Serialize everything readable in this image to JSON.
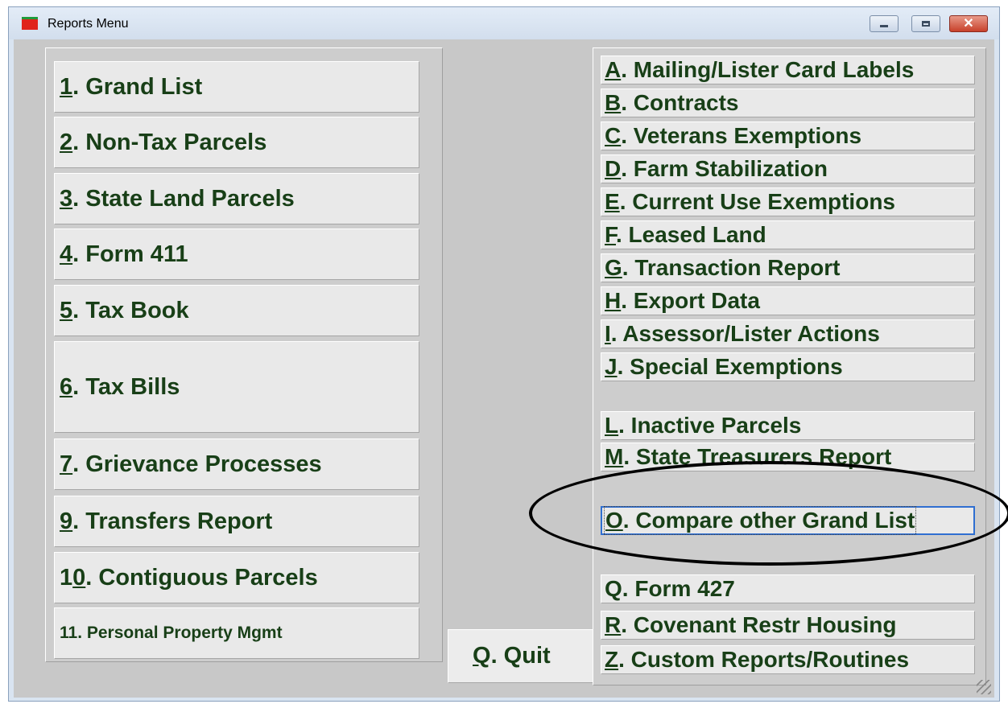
{
  "window": {
    "title": "Reports Menu",
    "controls": {
      "minimize": "minimize",
      "maximize": "maximize",
      "close": "✕"
    }
  },
  "left_menu": [
    {
      "key": "1",
      "rest": ".  Grand List"
    },
    {
      "key": "2",
      "rest": ".  Non-Tax Parcels"
    },
    {
      "key": "3",
      "rest": ".  State Land Parcels"
    },
    {
      "key": "4",
      "rest": ".  Form 411"
    },
    {
      "key": "5",
      "rest": ". Tax Book"
    },
    {
      "key": "6",
      "rest": ". Tax Bills"
    },
    {
      "key": "7",
      "rest": ". Grievance Processes"
    },
    {
      "key": "9",
      "rest": ". Transfers Report"
    },
    {
      "pre": "1",
      "key": "0",
      "rest": ". Contiguous Parcels"
    },
    {
      "label": "11. Personal Property Mgmt"
    }
  ],
  "quit": {
    "key": "Q",
    "rest": ".  Quit"
  },
  "right_menu": [
    {
      "key": "A",
      "rest": ". Mailing/Lister Card Labels"
    },
    {
      "key": "B",
      "rest": ". Contracts"
    },
    {
      "key": "C",
      "rest": ". Veterans Exemptions"
    },
    {
      "key": "D",
      "rest": ". Farm Stabilization"
    },
    {
      "key": "E",
      "rest": ". Current Use Exemptions"
    },
    {
      "key": "F",
      "rest": ". Leased Land"
    },
    {
      "key": "G",
      "rest": ". Transaction Report"
    },
    {
      "key": "H",
      "rest": ". Export Data"
    },
    {
      "key": "I",
      "rest": ". Assessor/Lister Actions"
    },
    {
      "key": "J",
      "rest": ". Special Exemptions"
    },
    {
      "key": "L",
      "rest": ". Inactive Parcels"
    },
    {
      "key": "M",
      "rest": ". State Treasurers Report"
    },
    {
      "key": "O",
      "rest": ". Compare other Grand List"
    },
    {
      "key": "",
      "rest": "Q. Form 427"
    },
    {
      "key": "R",
      "rest": ". Covenant Restr Housing"
    },
    {
      "key": "Z",
      "rest": ". Custom Reports/Routines"
    }
  ],
  "colors": {
    "text": "#183f17",
    "focus": "#2f6fd1",
    "annotation": "#000000"
  }
}
